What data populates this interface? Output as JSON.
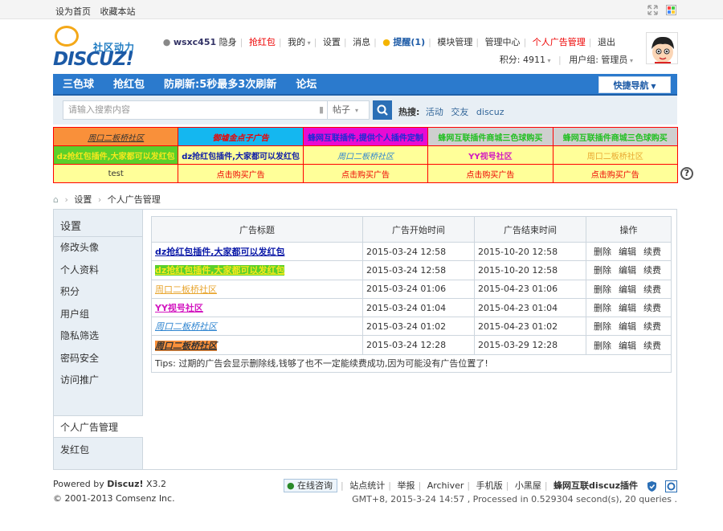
{
  "topbar": {
    "set_home": "设为首页",
    "bookmark": "收藏本站"
  },
  "logo": {
    "cn": "社区动力",
    "en": "DISCUZ!"
  },
  "user_menu": {
    "username": "wsxc451",
    "invisible": "隐身",
    "red_packet": "抢红包",
    "mine": "我的",
    "settings": "设置",
    "messages": "消息",
    "reminder": "提醒(1)",
    "module_manage": "模块管理",
    "admin_center": "管理中心",
    "personal_ads": "个人广告管理",
    "logout": "退出",
    "credits_label": "积分: 4911",
    "usergroup_label": "用户组: 管理员"
  },
  "nav": {
    "items": [
      "三色球",
      "抢红包",
      "防刷新:5秒最多3次刷新",
      "论坛"
    ],
    "quick": "快捷导航"
  },
  "search": {
    "placeholder": "请输入搜索内容",
    "scope": "帖子",
    "hot_label": "热搜:",
    "hot": [
      "活动",
      "交友",
      "discuz"
    ]
  },
  "ads": {
    "rows": [
      [
        {
          "text": "周口二板桥社区",
          "bg": "#f9903a",
          "color": "#333",
          "style": "italic-underline"
        },
        {
          "text": "御墟金点子广告",
          "bg": "#14b7f0",
          "color": "#e00",
          "style": "italic-bold"
        },
        {
          "text": "蜂网互联插件,提供个人插件定制",
          "bg": "#e80bd3",
          "color": "#1c2bd6",
          "style": "bold"
        },
        {
          "text": "蜂网互联插件商城三色球购买",
          "bg": "#cfcfcf",
          "color": "#23c023",
          "style": "bold"
        },
        {
          "text": "蜂网互联插件商城三色球购买",
          "bg": "#cfcfcf",
          "color": "#23c023",
          "style": "bold"
        }
      ],
      [
        {
          "text": "dz抢红包插件,大家都可以发红包",
          "bg": "#5bd02a",
          "color": "#f5e81e",
          "style": "bold"
        },
        {
          "text": "dz抢红包插件,大家都可以发红包",
          "bg": "#ffff99",
          "color": "#0c1aa8",
          "style": "bold"
        },
        {
          "text": "周口二板桥社区",
          "bg": "#ffff99",
          "color": "#2e84d0",
          "style": "italic"
        },
        {
          "text": "YY视号社区",
          "bg": "#ffff99",
          "color": "#d319c0",
          "style": "bold"
        },
        {
          "text": "周口二板桥社区",
          "bg": "#ffff99",
          "color": "#e8a630",
          "style": ""
        }
      ],
      [
        {
          "text": "test",
          "bg": "#ffff99",
          "color": "#333",
          "style": ""
        },
        {
          "text": "点击购买广告",
          "bg": "#ffff99",
          "color": "#e00",
          "style": ""
        },
        {
          "text": "点击购买广告",
          "bg": "#ffff99",
          "color": "#e00",
          "style": ""
        },
        {
          "text": "点击购买广告",
          "bg": "#ffff99",
          "color": "#e00",
          "style": ""
        },
        {
          "text": "点击购买广告",
          "bg": "#ffff99",
          "color": "#e00",
          "style": ""
        }
      ]
    ]
  },
  "breadcrumb": {
    "settings": "设置",
    "current": "个人广告管理"
  },
  "sidebar": {
    "title": "设置",
    "items": [
      "修改头像",
      "个人资料",
      "积分",
      "用户组",
      "隐私筛选",
      "密码安全",
      "访问推广"
    ],
    "active": "个人广告管理",
    "after": "发红包"
  },
  "table": {
    "headers": {
      "title": "广告标题",
      "start": "广告开始时间",
      "end": "广告结束时间",
      "ops": "操作"
    },
    "op_labels": {
      "delete": "删除",
      "edit": "编辑",
      "renew": "续费"
    },
    "rows": [
      {
        "title": "dz抢红包插件,大家都可以发红包",
        "color": "#0c1aa8",
        "bg": "",
        "style": "bold-underline",
        "start": "2015-03-24 12:58",
        "end": "2015-10-20 12:58"
      },
      {
        "title": "dz抢红包插件,大家都可以发红包",
        "color": "#f5e81e",
        "bg": "#5bd02a",
        "style": "bold-underline",
        "start": "2015-03-24 12:58",
        "end": "2015-10-20 12:58"
      },
      {
        "title": "周口二板桥社区",
        "color": "#e8a630",
        "bg": "",
        "style": "underline",
        "start": "2015-03-24 01:06",
        "end": "2015-04-23 01:06"
      },
      {
        "title": "YY视号社区",
        "color": "#d319c0",
        "bg": "",
        "style": "bold-underline",
        "start": "2015-03-24 01:04",
        "end": "2015-04-23 01:04"
      },
      {
        "title": "周口二板桥社区",
        "color": "#2e84d0",
        "bg": "",
        "style": "italic-underline",
        "start": "2015-03-24 01:02",
        "end": "2015-04-23 01:02"
      },
      {
        "title": "周口二板桥社区",
        "color": "#333",
        "bg": "#f9903a",
        "style": "italic-bold-underline",
        "start": "2015-03-24 12:28",
        "end": "2015-03-29 12:28"
      }
    ],
    "tips": "Tips: 过期的广告会显示删除线,钱够了也不一定能续费成功,因为可能没有广告位置了!"
  },
  "footer": {
    "powered_prefix": "Powered by ",
    "powered_brand": "Discuz!",
    "powered_version": " X3.2",
    "copyright": "© 2001-2013 Comsenz Inc.",
    "online_consult": "在线咨询",
    "links": [
      "站点统计",
      "举报",
      "Archiver",
      "手机版",
      "小黑屋"
    ],
    "brand_link": "蜂网互联discuz插件",
    "timing": "GMT+8, 2015-3-24 14:57 , Processed in 0.529304 second(s), 20 queries ."
  }
}
